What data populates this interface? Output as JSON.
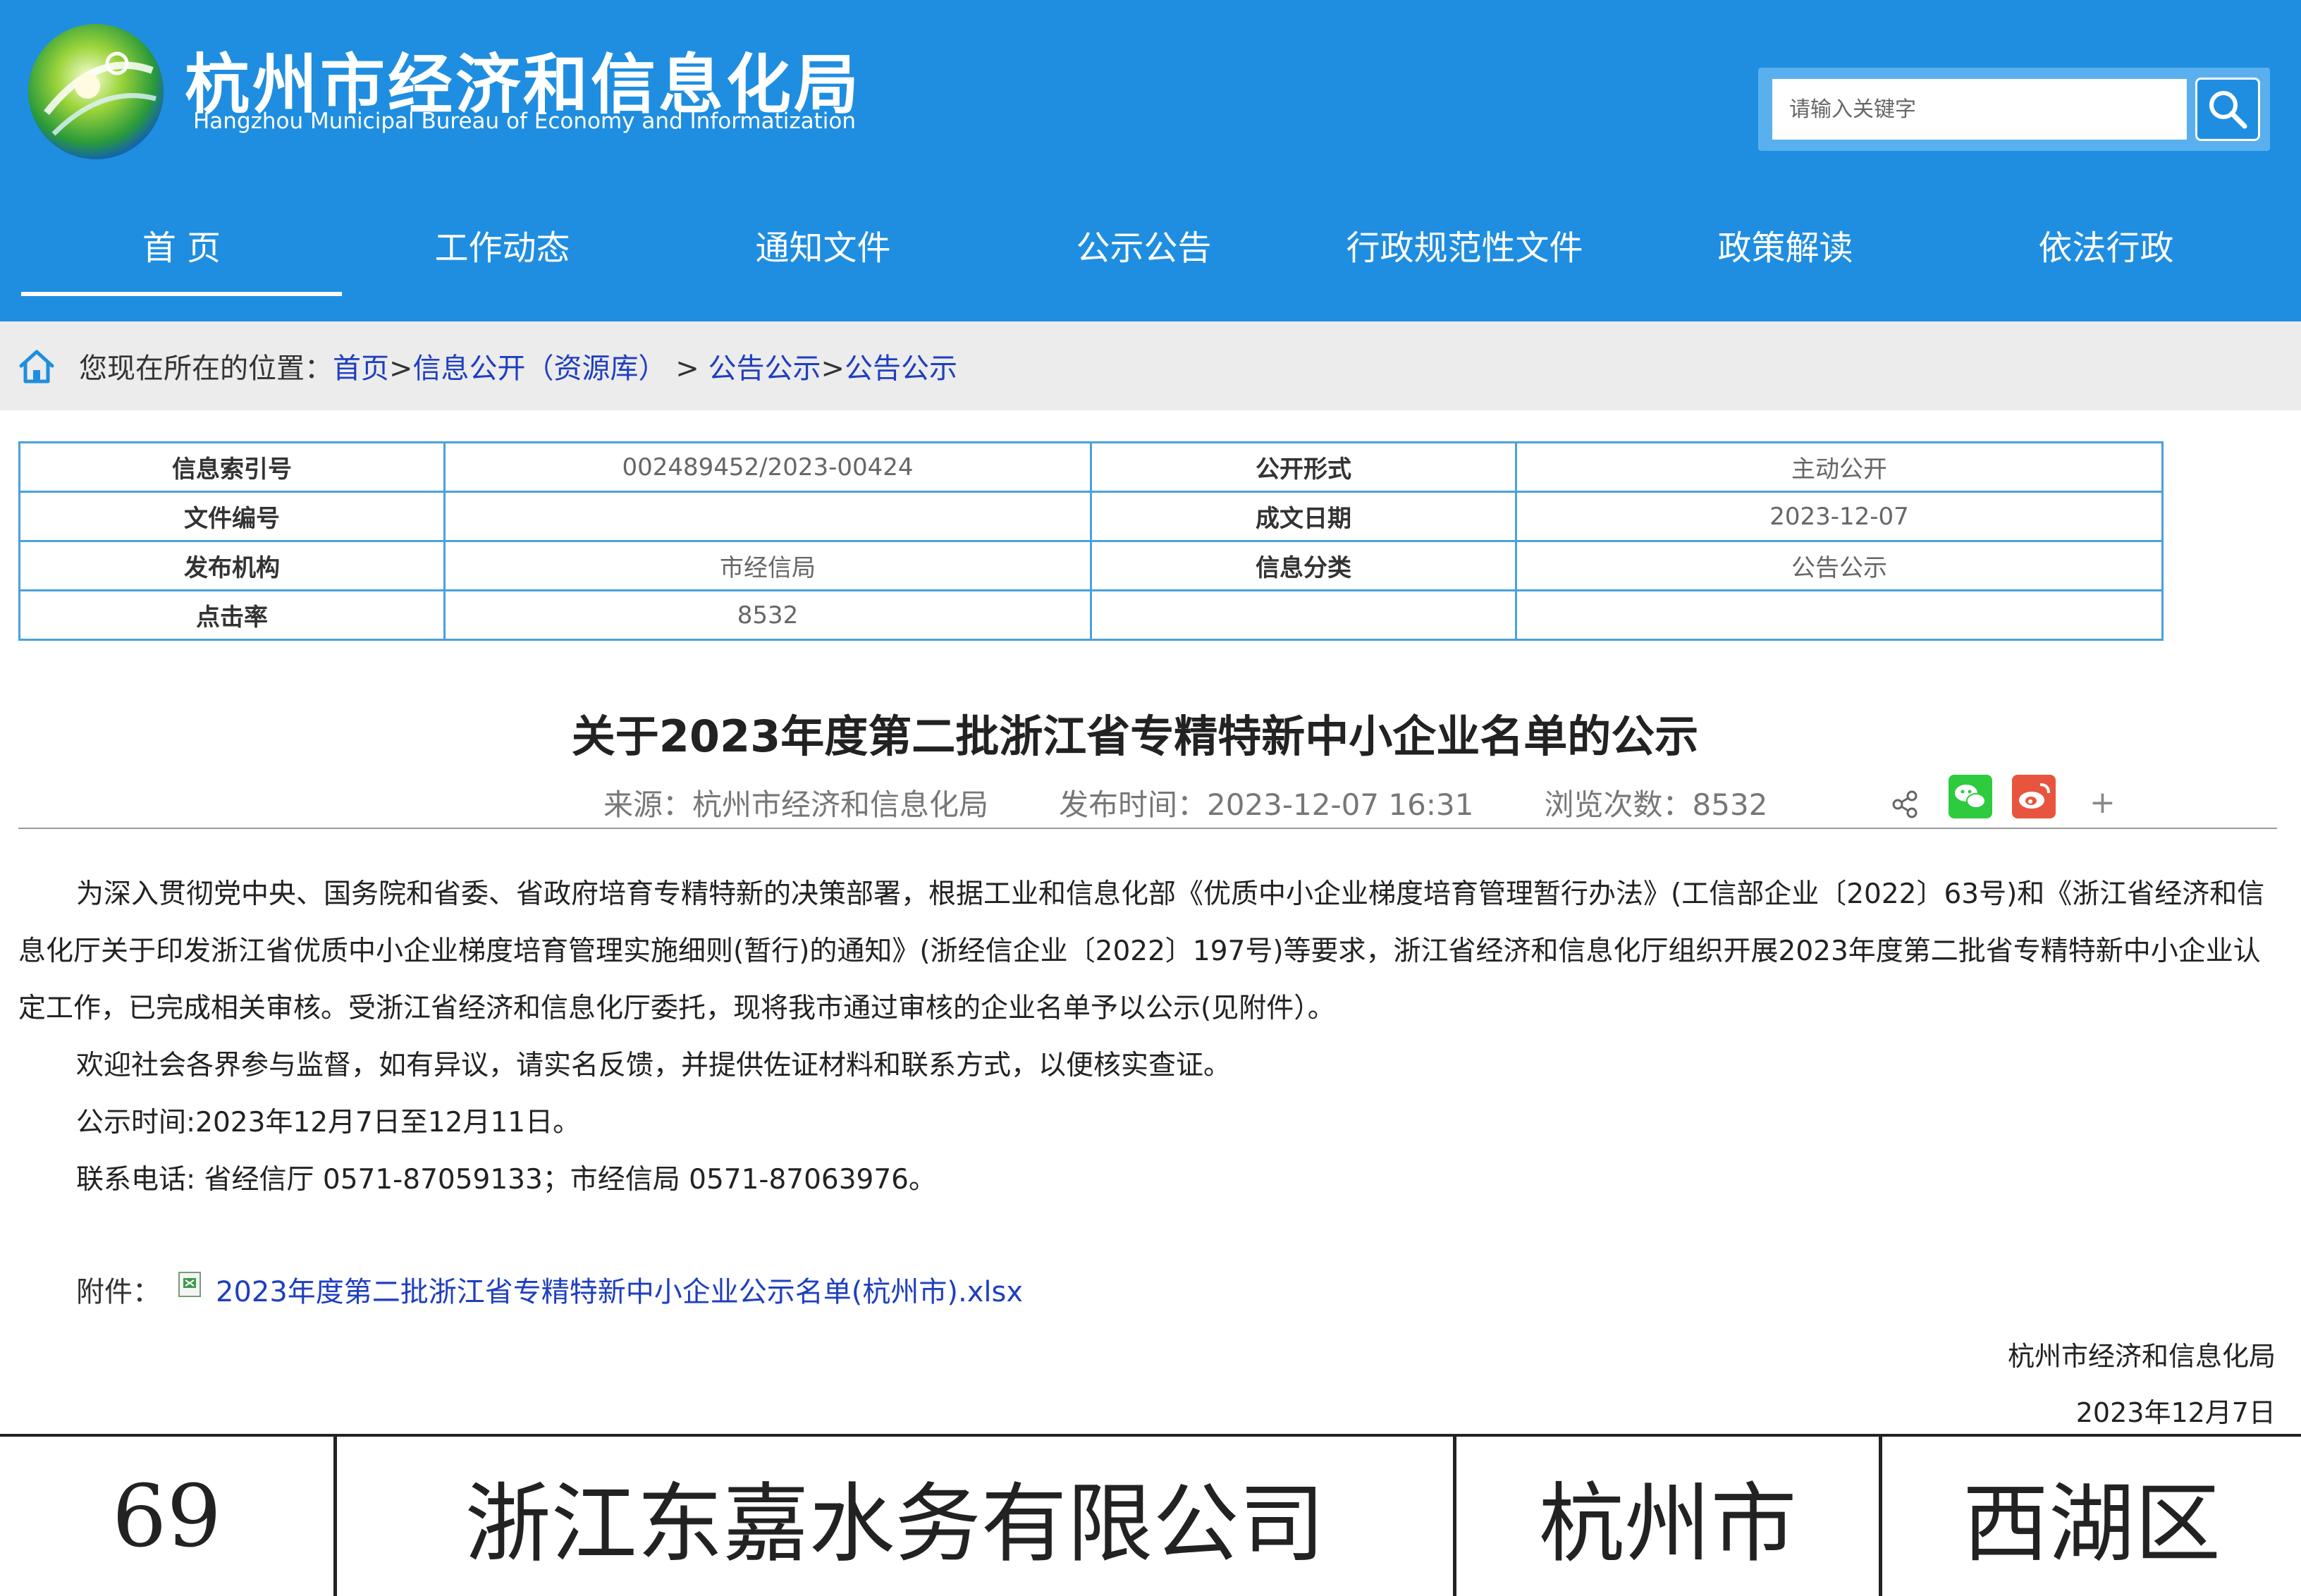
{
  "header": {
    "title": "杭州市经济和信息化局",
    "subtitle": "Hangzhou Municipal Bureau of Economy and Informatization",
    "search_placeholder": "请输入关键字"
  },
  "nav": {
    "items": [
      "首 页",
      "工作动态",
      "通知文件",
      "公示公告",
      "行政规范性文件",
      "政策解读",
      "依法行政"
    ],
    "active": "首 页"
  },
  "breadcrumb": {
    "prefix": "您现在所在的位置：",
    "items": [
      "首页",
      "信息公开（资源库）",
      "公告公示",
      "公告公示"
    ],
    "separators": [
      ">",
      " > ",
      ">"
    ]
  },
  "meta": {
    "index_label": "信息索引号",
    "index_value": "002489452/2023-00424",
    "form_label": "公开形式",
    "form_value": "主动公开",
    "docno_label": "文件编号",
    "docno_value": "",
    "date_label": "成文日期",
    "date_value": "2023-12-07",
    "org_label": "发布机构",
    "org_value": "市经信局",
    "category_label": "信息分类",
    "category_value": "公告公示",
    "clicks_label": "点击率",
    "clicks_value": "8532"
  },
  "article": {
    "title": "关于2023年度第二批浙江省专精特新中小企业名单的公示",
    "source": "来源：杭州市经济和信息化局",
    "publish_time": "发布时间：2023-12-07 16:31",
    "views": "浏览次数：8532",
    "paragraphs": [
      "为深入贯彻党中央、国务院和省委、省政府培育专精特新的决策部署，根据工业和信息化部《优质中小企业梯度培育管理暂行办法》(工信部企业〔2022〕63号)和《浙江省经济和信息化厅关于印发浙江省优质中小企业梯度培育管理实施细则(暂行)的通知》(浙经信企业〔2022〕197号)等要求，浙江省经济和信息化厅组织开展2023年度第二批省专精特新中小企业认定工作，已完成相关审核。受浙江省经济和信息化厅委托，现将我市通过审核的企业名单予以公示(见附件）。",
      "欢迎社会各界参与监督，如有异议，请实名反馈，并提供佐证材料和联系方式，以便核实查证。",
      "公示时间:2023年12月7日至12月11日。",
      "联系电话: 省经信厅 0571-87059133；市经信局 0571-87063976。"
    ],
    "attachment_label": "附件：",
    "attachment_name": "2023年度第二批浙江省专精特新中小企业公示名单(杭州市).xlsx",
    "signature_org": "杭州市经济和信息化局",
    "signature_date": "2023年12月7日"
  },
  "share": {
    "icons": [
      "share-icon",
      "wechat-icon",
      "weibo-icon",
      "plus-icon"
    ],
    "plus_label": "+"
  },
  "doc_table_row": {
    "number": "69",
    "company": "浙江东嘉水务有限公司",
    "city": "杭州市",
    "district": "西湖区"
  },
  "colors": {
    "header_blue": "#1f8ee0",
    "link_blue": "#1f3fbf",
    "table_border": "#4ba0dd",
    "wechat_green": "#2ecb3e",
    "weibo_red": "#e8553e"
  }
}
